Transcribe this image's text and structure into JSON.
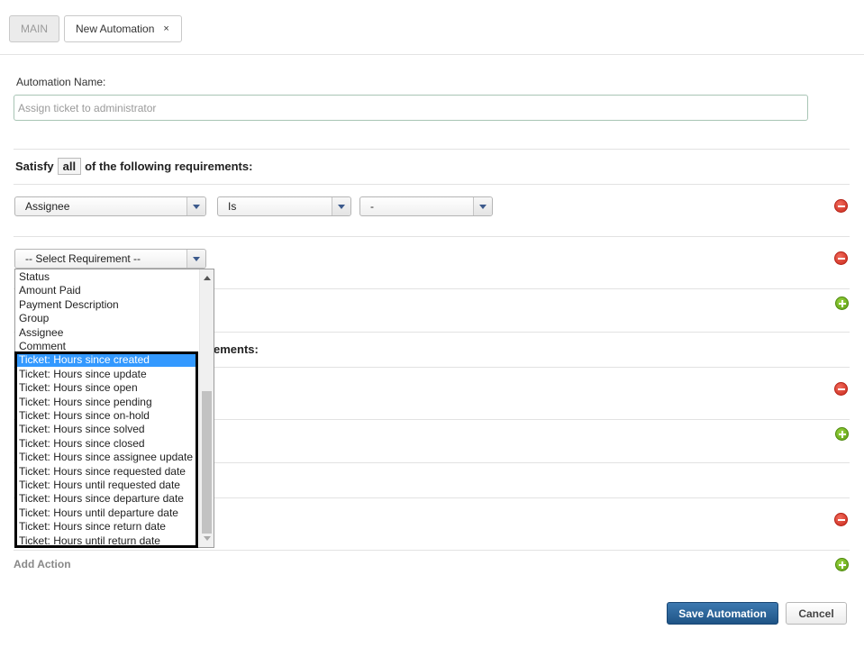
{
  "tabs": {
    "main_label": "MAIN",
    "new_label": "New Automation",
    "close_glyph": "×"
  },
  "form": {
    "name_label": "Automation Name:",
    "name_placeholder": "Assign ticket to administrator"
  },
  "requirements": {
    "satisfy_prefix": "Satisfy",
    "satisfy_mode": "all",
    "satisfy_suffix": "of the following requirements:",
    "row1": {
      "field": "Assignee",
      "operator": "Is",
      "value": "-"
    },
    "row2": {
      "field": "-- Select Requirement --"
    }
  },
  "requirements2": {
    "partial_text": "ements:"
  },
  "dropdown": {
    "items": [
      "Status",
      "Amount Paid",
      "Payment Description",
      "Group",
      "Assignee",
      "Comment",
      "Ticket: Hours since created",
      "Ticket: Hours since update",
      "Ticket: Hours since open",
      "Ticket: Hours since pending",
      "Ticket: Hours since on-hold",
      "Ticket: Hours since solved",
      "Ticket: Hours since closed",
      "Ticket: Hours since assignee update",
      "Ticket: Hours since requested date",
      "Ticket: Hours until requested date",
      "Ticket: Hours since departure date",
      "Ticket: Hours until departure date",
      "Ticket: Hours since return date",
      "Ticket: Hours until return date"
    ],
    "selected_index": 6
  },
  "actions": {
    "add_action_label": "Add Action"
  },
  "buttons": {
    "save_label": "Save Automation",
    "cancel_label": "Cancel"
  },
  "colors": {
    "primary": "#2a6496",
    "remove": "#d9342b",
    "add": "#7cbb27",
    "selection": "#3399ff"
  }
}
